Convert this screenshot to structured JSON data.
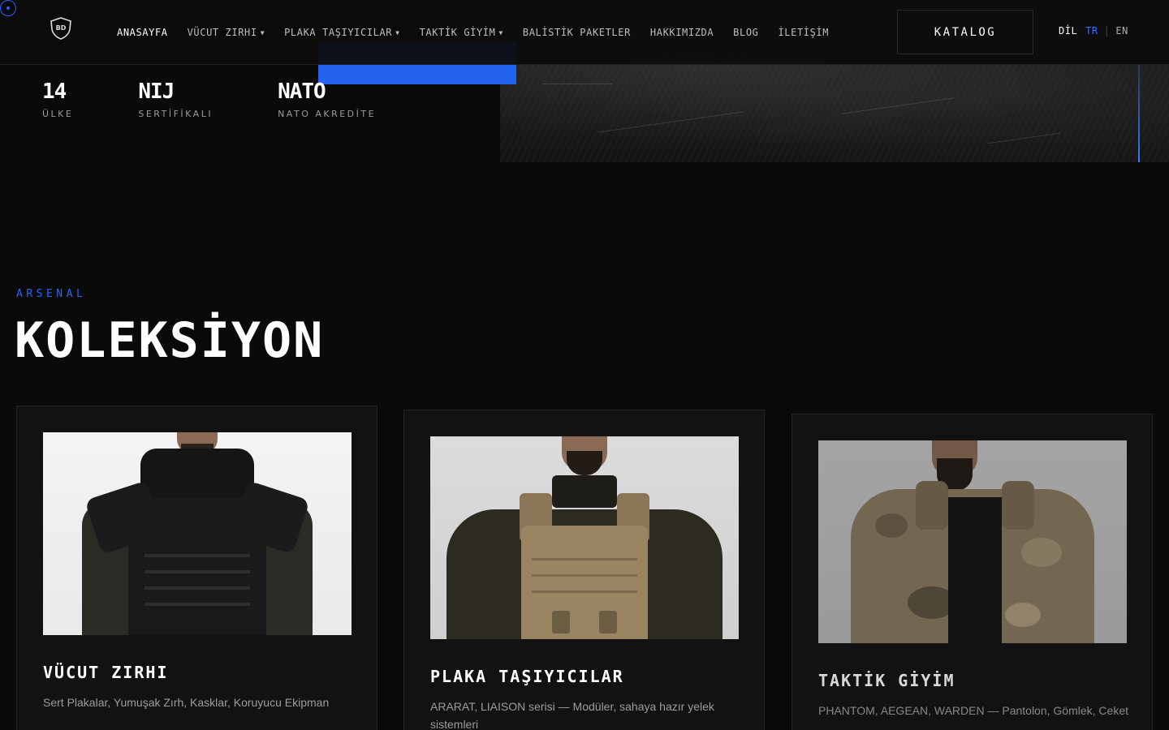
{
  "nav": {
    "menu": [
      {
        "label": "ANASAYFA",
        "active": true,
        "dropdown": false
      },
      {
        "label": "VÜCUT ZIRHI",
        "active": false,
        "dropdown": true
      },
      {
        "label": "PLAKA TAŞIYICILAR",
        "active": false,
        "dropdown": true
      },
      {
        "label": "TAKTİK GİYİM",
        "active": false,
        "dropdown": true
      },
      {
        "label": "BALİSTİK PAKETLER",
        "active": false,
        "dropdown": false
      },
      {
        "label": "HAKKIMIZDA",
        "active": false,
        "dropdown": false
      },
      {
        "label": "BLOG",
        "active": false,
        "dropdown": false
      },
      {
        "label": "İLETİŞİM",
        "active": false,
        "dropdown": false
      }
    ],
    "katalog_label": "KATALOG",
    "lang": {
      "label": "DİL",
      "options": [
        "TR",
        "EN"
      ],
      "selected": "TR"
    },
    "logo_text": "BD"
  },
  "stats": [
    {
      "value": "14",
      "label": "ÜLKE"
    },
    {
      "value": "NIJ",
      "label": "SERTİFİKALI"
    },
    {
      "value": "NATO",
      "label": "NATO AKREDİTE"
    }
  ],
  "collection": {
    "eyebrow": "ARSENAL",
    "title": "KOLEKSİYON",
    "cards": [
      {
        "title": "VÜCUT ZIRHI",
        "desc": "Sert Plakalar, Yumuşak Zırh, Kasklar, Koruyucu Ekipman"
      },
      {
        "title": "PLAKA TAŞIYICILAR",
        "desc": "ARARAT, LIAISON serisi — Modüler, sahaya hazır yelek sistemleri"
      },
      {
        "title": "TAKTİK GİYİM",
        "desc": "PHANTOM, AEGEAN, WARDEN — Pantolon, Gömlek, Ceket"
      }
    ]
  },
  "colors": {
    "accent": "#2463eb",
    "background": "#0a0a0a",
    "card": "#121212"
  }
}
